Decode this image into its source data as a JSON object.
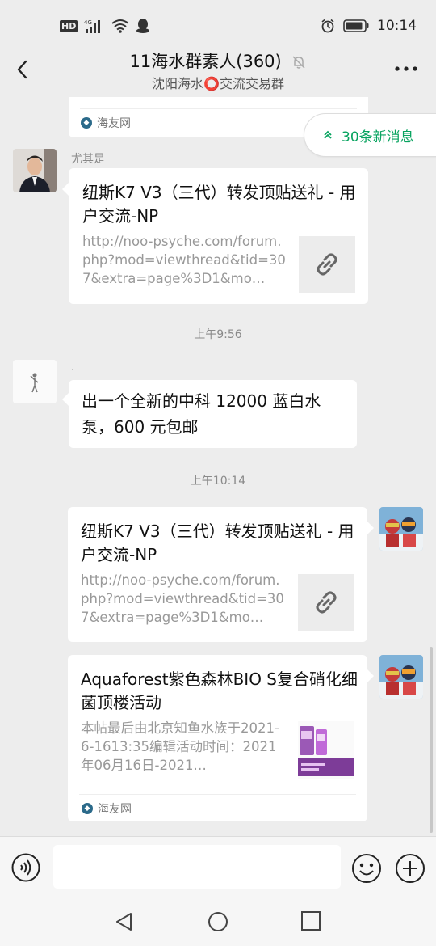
{
  "status_bar": {
    "time": "10:14",
    "hd_label": "HD",
    "network": "4G"
  },
  "header": {
    "title": "11海水群素人(360)",
    "subtitle": "沈阳海水⭕交流交易群",
    "muted": true
  },
  "new_messages_badge": "30条新消息",
  "messages": [
    {
      "type": "link-card-partial",
      "side": "left",
      "source": "海友网"
    },
    {
      "type": "link-card",
      "side": "left",
      "sender": "尤其是",
      "title": "纽斯K7 V3（三代）转发顶贴送礼 - 用户交流-NP",
      "desc": "http://noo-psyche.com/forum.php?mod=viewthread&tid=307&extra=page%3D1&mo…"
    },
    {
      "type": "timestamp",
      "text": "上午9:56"
    },
    {
      "type": "text",
      "side": "left",
      "sender": ".",
      "text": "出一个全新的中科 12000 蓝白水泵，600 元包邮"
    },
    {
      "type": "timestamp",
      "text": "上午10:14"
    },
    {
      "type": "link-card",
      "side": "right",
      "title": "纽斯K7 V3（三代）转发顶贴送礼 - 用户交流-NP",
      "desc": "http://noo-psyche.com/forum.php?mod=viewthread&tid=307&extra=page%3D1&mo…"
    },
    {
      "type": "link-card",
      "side": "right",
      "title": "Aquaforest紫色森林BIO S复合硝化细菌顶楼活动",
      "desc": "本帖最后由北京知鱼水族于2021-6-1613:35编辑活动时间：2021年06月16日-2021…",
      "source": "海友网"
    }
  ],
  "input": {
    "placeholder": ""
  },
  "colors": {
    "accent_green": "#07a35f",
    "background": "#ededed"
  }
}
